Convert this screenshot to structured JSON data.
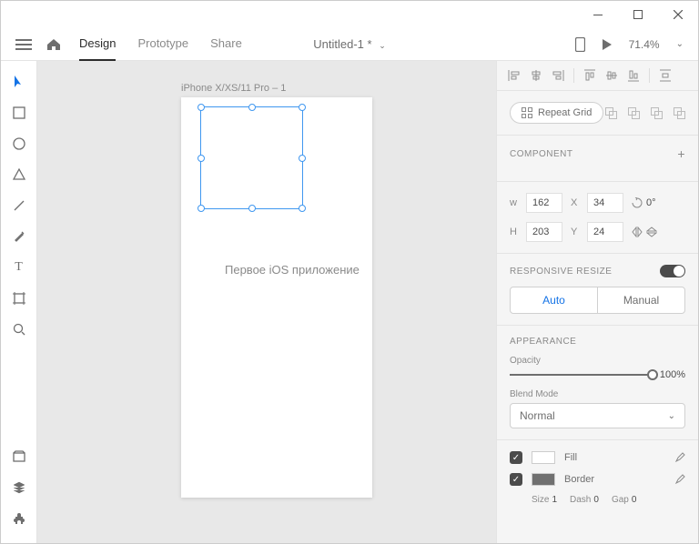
{
  "nav": {
    "design": "Design",
    "prototype": "Prototype",
    "share": "Share",
    "doc_title": "Untitled-1 *",
    "zoom": "71.4%"
  },
  "artboard": {
    "label": "iPhone X/XS/11 Pro – 1",
    "text": "Первое iOS приложение"
  },
  "panel": {
    "repeat_grid": "Repeat Grid",
    "component": "COMPONENT",
    "transform": {
      "w": "162",
      "x": "34",
      "h": "203",
      "y": "24",
      "rotation": "0°"
    },
    "responsive": {
      "title": "RESPONSIVE RESIZE",
      "auto": "Auto",
      "manual": "Manual"
    },
    "appearance": {
      "title": "APPEARANCE",
      "opacity_label": "Opacity",
      "opacity_value": "100%",
      "blend_label": "Blend Mode",
      "blend_value": "Normal",
      "fill": "Fill",
      "border": "Border",
      "size_label": "Size",
      "size_val": "1",
      "dash_label": "Dash",
      "dash_val": "0",
      "gap_label": "Gap",
      "gap_val": "0"
    }
  }
}
